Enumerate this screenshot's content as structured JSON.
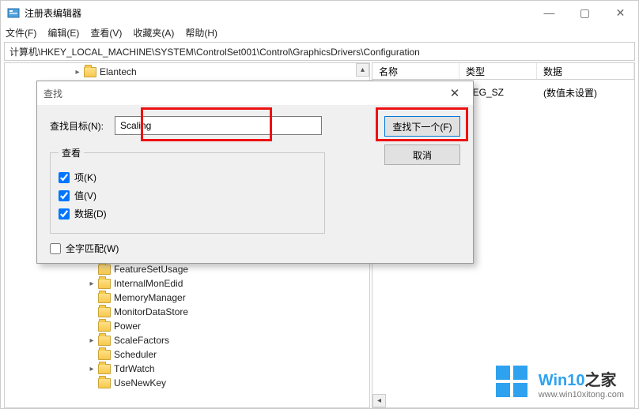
{
  "window": {
    "title": "注册表编辑器",
    "controls": {
      "min": "—",
      "max": "▢",
      "close": "✕"
    }
  },
  "menu": {
    "file": "文件(F)",
    "edit": "编辑(E)",
    "view": "查看(V)",
    "favorites": "收藏夹(A)",
    "help": "帮助(H)"
  },
  "address": "计算机\\HKEY_LOCAL_MACHINE\\SYSTEM\\ControlSet001\\Control\\GraphicsDrivers\\Configuration",
  "tree": {
    "top_item": "Elantech",
    "items": [
      {
        "label": "FeatureSetUsage",
        "expand": "none"
      },
      {
        "label": "InternalMonEdid",
        "expand": "closed"
      },
      {
        "label": "MemoryManager",
        "expand": "none"
      },
      {
        "label": "MonitorDataStore",
        "expand": "none"
      },
      {
        "label": "Power",
        "expand": "none"
      },
      {
        "label": "ScaleFactors",
        "expand": "closed"
      },
      {
        "label": "Scheduler",
        "expand": "none"
      },
      {
        "label": "TdrWatch",
        "expand": "closed"
      },
      {
        "label": "UseNewKey",
        "expand": "none"
      }
    ]
  },
  "list": {
    "col_name": "名称",
    "col_type": "类型",
    "col_data": "数据",
    "rows": [
      {
        "name": "",
        "type": "REG_SZ",
        "data": "(数值未设置)"
      }
    ]
  },
  "dialog": {
    "title": "查找",
    "target_label": "查找目标(N):",
    "target_value": "Scaling",
    "look_at_legend": "查看",
    "chk_keys": "项(K)",
    "chk_values": "值(V)",
    "chk_data": "数据(D)",
    "chk_whole": "全字匹配(W)",
    "btn_find_next": "查找下一个(F)",
    "btn_cancel": "取消"
  },
  "watermark": {
    "brand_main": "Win10",
    "brand_suffix": "之家",
    "url": "www.win10xitong.com"
  }
}
